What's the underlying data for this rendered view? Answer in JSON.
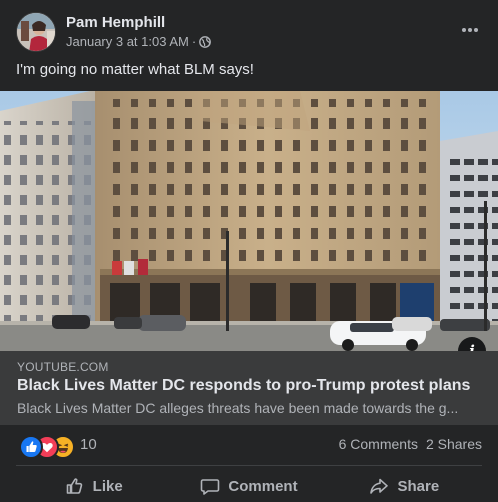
{
  "post": {
    "author": "Pam Hemphill",
    "date": "January 3 at 1:03 AM",
    "separator": "·",
    "audience_icon": "globe-icon",
    "menu_icon": "more-options-icon",
    "caption": "I'm going no matter what BLM says!"
  },
  "link_preview": {
    "domain": "YOUTUBE.COM",
    "title": "Black Lives Matter DC responds to pro-Trump protest plans",
    "description": "Black Lives Matter DC alleges threats have been made towards the g...",
    "info_icon_glyph": "i"
  },
  "engagement": {
    "reaction_icons": [
      "like-reaction-icon",
      "love-reaction-icon",
      "haha-reaction-icon"
    ],
    "reaction_count": "10",
    "comments": "6 Comments",
    "shares": "2 Shares"
  },
  "actions": {
    "like": "Like",
    "comment": "Comment",
    "share": "Share"
  },
  "colors": {
    "background": "#242526",
    "link_box": "#3a3b3c",
    "primary_text": "#e4e6eb",
    "secondary_text": "#b0b3b8",
    "like_blue": "#1877f2",
    "love_red": "#f33e58",
    "haha_yellow": "#f7b125"
  }
}
